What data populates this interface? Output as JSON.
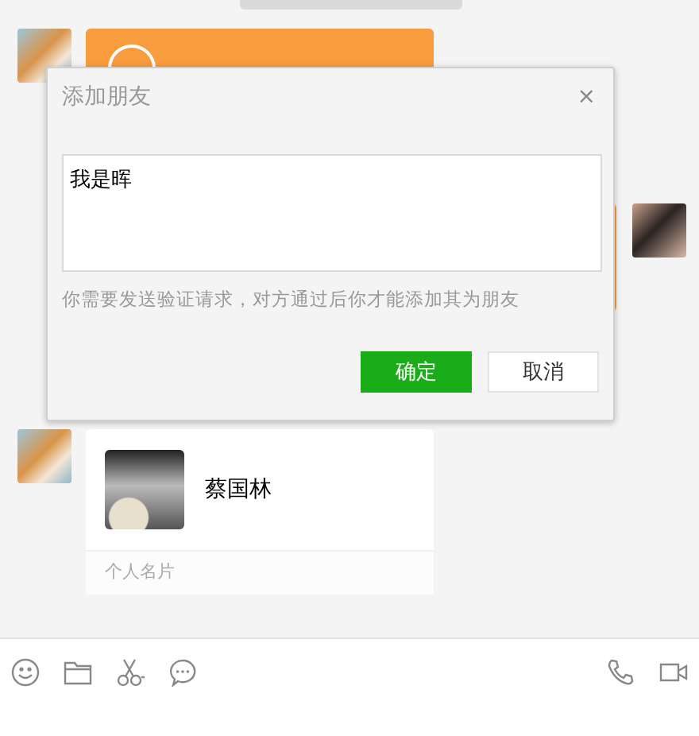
{
  "messages": [
    {
      "kind": "transfer_received"
    },
    {
      "kind": "transfer_sent"
    },
    {
      "kind": "contact_card_received",
      "name": "蔡国林",
      "footer": "个人名片"
    }
  ],
  "dialog": {
    "title": "添加朋友",
    "close": "×",
    "message_value": "我是晖",
    "hint": "你需要发送验证请求，对方通过后你才能添加其为朋友",
    "buttons": [
      {
        "label": "确定",
        "kind": "primary"
      },
      {
        "label": "取消",
        "kind": "secondary"
      }
    ]
  }
}
